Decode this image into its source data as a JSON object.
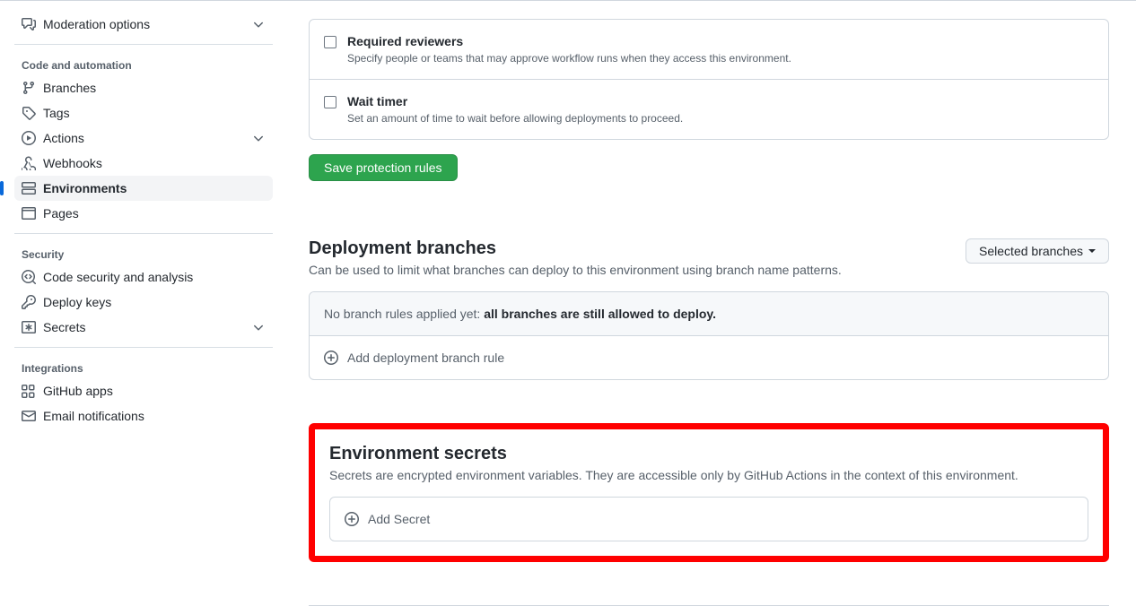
{
  "sidebar": {
    "moderation": "Moderation options",
    "code_heading": "Code and automation",
    "branches": "Branches",
    "tags": "Tags",
    "actions": "Actions",
    "webhooks": "Webhooks",
    "environments": "Environments",
    "pages": "Pages",
    "security_heading": "Security",
    "code_security": "Code security and analysis",
    "deploy_keys": "Deploy keys",
    "secrets": "Secrets",
    "integrations_heading": "Integrations",
    "github_apps": "GitHub apps",
    "email_notifications": "Email notifications"
  },
  "protection": {
    "reviewers_title": "Required reviewers",
    "reviewers_desc": "Specify people or teams that may approve workflow runs when they access this environment.",
    "wait_title": "Wait timer",
    "wait_desc": "Set an amount of time to wait before allowing deployments to proceed.",
    "save_button": "Save protection rules"
  },
  "deployment": {
    "title": "Deployment branches",
    "desc": "Can be used to limit what branches can deploy to this environment using branch name patterns.",
    "dropdown": "Selected branches",
    "no_rules_prefix": "No branch rules applied yet: ",
    "no_rules_bold": "all branches are still allowed to deploy.",
    "add_rule": "Add deployment branch rule"
  },
  "secrets": {
    "title": "Environment secrets",
    "desc": "Secrets are encrypted environment variables. They are accessible only by GitHub Actions in the context of this environment.",
    "add_secret": "Add Secret"
  }
}
